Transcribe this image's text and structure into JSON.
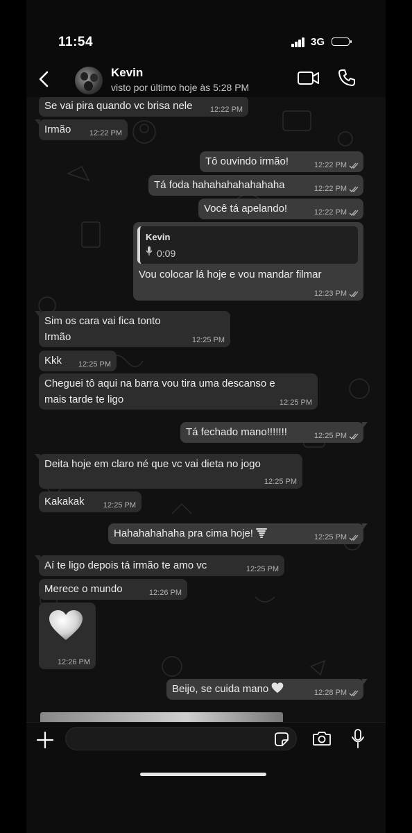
{
  "status_bar": {
    "time": "11:54",
    "network": "3G"
  },
  "header": {
    "contact_name": "Kevin",
    "last_seen": "visto por último hoje às 5:28 PM"
  },
  "messages": [
    {
      "dir": "in",
      "text": "Se vai pira quando vc brisa nele",
      "time": "12:22 PM"
    },
    {
      "dir": "in",
      "text": "Irmão",
      "time": "12:22 PM"
    },
    {
      "dir": "out",
      "text": "Tô ouvindo irmão!",
      "time": "12:22 PM"
    },
    {
      "dir": "out",
      "text": "Tá foda hahahahahahahaha",
      "time": "12:22 PM"
    },
    {
      "dir": "out",
      "text": "Você tá apelando!",
      "time": "12:22 PM"
    },
    {
      "dir": "out",
      "reply_to": {
        "name": "Kevin",
        "duration": "0:09"
      },
      "text": "Vou colocar lá hoje e vou mandar filmar",
      "time": "12:23 PM"
    },
    {
      "dir": "in",
      "text": "Sim os cara vai fica tonto",
      "text2": "Irmão",
      "time": "12:25 PM"
    },
    {
      "dir": "in",
      "text": "Kkk",
      "time": "12:25 PM"
    },
    {
      "dir": "in",
      "text": "Cheguei tô aqui na barra vou tira uma descanso e",
      "text2": "mais tarde te ligo",
      "time": "12:25 PM"
    },
    {
      "dir": "out",
      "text": "Tá fechado mano!!!!!!!",
      "time": "12:25 PM"
    },
    {
      "dir": "in",
      "text": "Deita hoje em claro né que vc vai dieta no jogo",
      "time": "12:25 PM"
    },
    {
      "dir": "in",
      "text": "Kakakak",
      "time": "12:25 PM"
    },
    {
      "dir": "out",
      "text": "Hahahahahaha pra cima hoje!",
      "emoji": "tornado",
      "time": "12:25 PM"
    },
    {
      "dir": "in",
      "text": "Aí te ligo depois tá irmão te amo vc",
      "time": "12:25 PM"
    },
    {
      "dir": "in",
      "text": "Merece o mundo",
      "time": "12:26 PM"
    },
    {
      "dir": "in",
      "emoji": "white-heart",
      "time": "12:26 PM"
    },
    {
      "dir": "out",
      "text": "Beijo, se cuida mano",
      "emoji": "white-heart",
      "time": "12:28 PM"
    }
  ],
  "composer": {
    "value": ""
  },
  "icons": {
    "back": "chevron-left-icon",
    "video": "video-camera-icon",
    "call": "phone-icon",
    "plus": "plus-icon",
    "sticker": "sticker-icon",
    "camera": "camera-icon",
    "mic": "microphone-icon",
    "read": "double-check-icon"
  },
  "colors": {
    "incoming_bubble": "#2d2d2d",
    "outgoing_bubble": "#3b3b3b",
    "background": "#0e0e0e"
  }
}
